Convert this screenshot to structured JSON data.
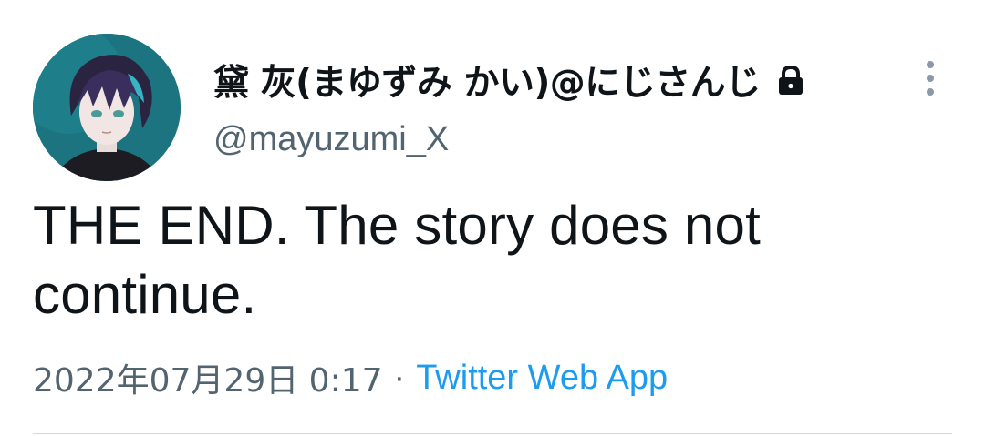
{
  "author": {
    "display_name": "黛 灰(まゆずみ かい)@にじさんじ",
    "handle": "@mayuzumi_X",
    "protected": true
  },
  "tweet": {
    "text": "THE END. The story does not continue."
  },
  "meta": {
    "timestamp": "2022年07月29日 0:17",
    "separator": "·",
    "source": "Twitter Web App"
  },
  "icons": {
    "avatar": "avatar-image",
    "lock": "lock-icon",
    "more": "more-vertical-icon"
  },
  "colors": {
    "text_primary": "#0f1419",
    "text_secondary": "#536471",
    "link": "#1d9bf0",
    "divider": "#cfd9de"
  }
}
